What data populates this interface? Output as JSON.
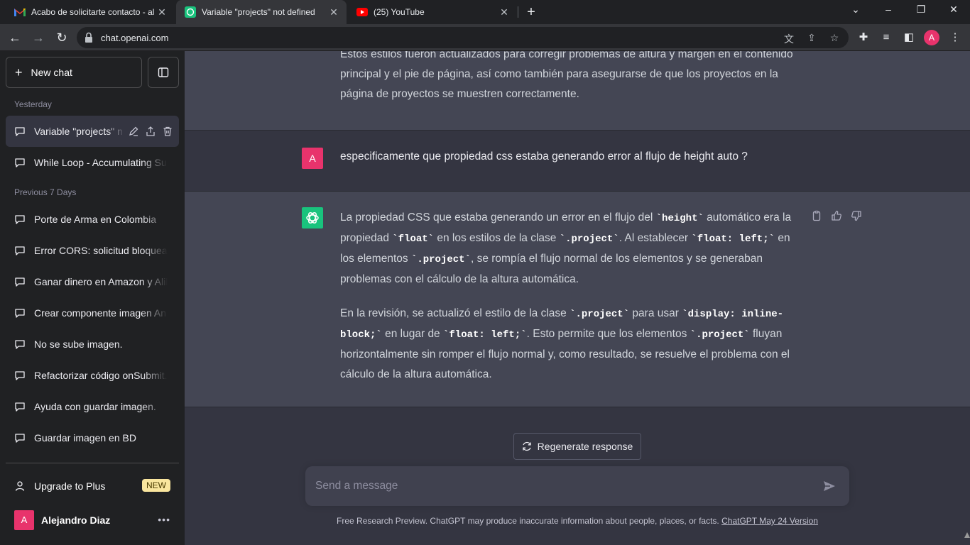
{
  "browser": {
    "tabs": [
      {
        "title": "Acabo de solicitarte contacto - al",
        "icon": "gmail-icon"
      },
      {
        "title": "Variable \"projects\" not defined",
        "icon": "openai-icon"
      },
      {
        "title": "(25) YouTube",
        "icon": "youtube-icon"
      }
    ],
    "url": "chat.openai.com",
    "profile_initial": "A"
  },
  "sidebar": {
    "new_chat": "New chat",
    "sections": [
      {
        "label": "Yesterday",
        "items": [
          {
            "title": "Variable \"projects\" n",
            "active": true
          },
          {
            "title": "While Loop - Accumulating Su"
          }
        ]
      },
      {
        "label": "Previous 7 Days",
        "items": [
          {
            "title": "Porte de Arma en Colombia"
          },
          {
            "title": "Error CORS: solicitud bloquead"
          },
          {
            "title": "Ganar dinero en Amazon y Alib"
          },
          {
            "title": "Crear componente imagen An"
          },
          {
            "title": "No se sube imagen."
          },
          {
            "title": "Refactorizar código onSubmit."
          },
          {
            "title": "Ayuda con guardar imagen."
          },
          {
            "title": "Guardar imagen en BD"
          }
        ]
      }
    ],
    "upgrade": "Upgrade to Plus",
    "new_badge": "NEW",
    "user_name": "Alejandro Diaz",
    "user_initial": "A"
  },
  "conversation": {
    "prev_assistant_tail": "Estos estilos fueron actualizados para corregir problemas de altura y margen en el contenido principal y el pie de página, así como también para asegurarse de que los proyectos en la página de proyectos se muestren correctamente.",
    "user_message": "especificamente que propiedad css estaba generando error al flujo de height auto ?",
    "user_initial": "A",
    "assistant_p1": [
      "La propiedad CSS que estaba generando un error en el flujo del ",
      "`height`",
      " automático era la propiedad ",
      "`float`",
      " en los estilos de la clase ",
      "`.project`",
      ". Al establecer ",
      "`float: left;`",
      " en los elementos ",
      "`.project`",
      ", se rompía el flujo normal de los elementos y se generaban problemas con el cálculo de la altura automática."
    ],
    "assistant_p2": [
      "En la revisión, se actualizó el estilo de la clase ",
      "`.project`",
      " para usar ",
      "`display: inline-block;`",
      " en lugar de ",
      "`float: left;`",
      ". Esto permite que los elementos ",
      "`.project`",
      " fluyan horizontalmente sin romper el flujo normal y, como resultado, se resuelve el problema con el cálculo de la altura automática."
    ]
  },
  "composer": {
    "regenerate": "Regenerate response",
    "placeholder": "Send a message"
  },
  "footer": {
    "note": "Free Research Preview. ChatGPT may produce inaccurate information about people, places, or facts. ",
    "link": "ChatGPT May 24 Version"
  },
  "colors": {
    "accent_green": "#19c37d",
    "avatar_pink": "#e8336c",
    "sidebar_bg": "#202123",
    "main_bg": "#343541",
    "assistant_bg": "#444654"
  }
}
